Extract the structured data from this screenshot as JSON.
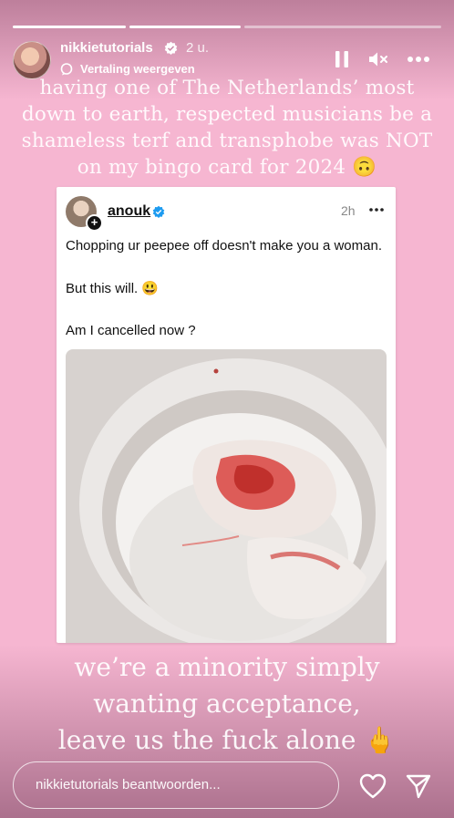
{
  "story": {
    "progress_segments": [
      1,
      1,
      0
    ],
    "username": "nikkietutorials",
    "time_ago": "2 u.",
    "translate_label": "Vertaling weergeven",
    "caption_top": [
      "having one of The Netherlands’ most",
      "down to earth, respected musicians be a",
      "shameless terf and transphobe was NOT",
      "on my bingo card for 2024 🙃"
    ],
    "caption_bottom": [
      "we’re a minority simply",
      "wanting acceptance,",
      "leave us the fuck alone 🖕"
    ]
  },
  "post": {
    "username": "anouk",
    "time_ago": "2h",
    "line1": "Chopping ur peepee off doesn't make you a woman.",
    "line2": "But this will. 😃",
    "line3": "Am I cancelled now ?"
  },
  "reply": {
    "placeholder": "nikkietutorials beantwoorden..."
  },
  "icons": {
    "verified": "verified-badge-icon",
    "translate": "speech-bubble-icon",
    "pause": "pause-icon",
    "mute": "speaker-muted-icon",
    "more": "more-horizontal-icon",
    "heart": "heart-icon",
    "send": "send-icon"
  },
  "colors": {
    "background": "#f6b6d1",
    "verified_blue": "#1d9bf0"
  }
}
